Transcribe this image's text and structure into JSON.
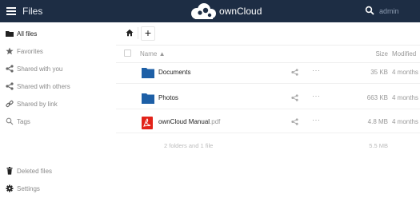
{
  "topbar": {
    "menu_icon": "hamburger-icon",
    "app_title": "Files",
    "logo_text": "ownCloud",
    "search_icon": "search-icon",
    "user": "admin"
  },
  "sidebar": {
    "items": [
      {
        "label": "All files",
        "icon": "folder-icon",
        "active": true
      },
      {
        "label": "Favorites",
        "icon": "star-icon"
      },
      {
        "label": "Shared with you",
        "icon": "share-icon"
      },
      {
        "label": "Shared with others",
        "icon": "share-icon"
      },
      {
        "label": "Shared by link",
        "icon": "link-icon"
      },
      {
        "label": "Tags",
        "icon": "tag-icon"
      }
    ],
    "bottom": [
      {
        "label": "Deleted files",
        "icon": "trash-icon"
      },
      {
        "label": "Settings",
        "icon": "gear-icon"
      }
    ]
  },
  "breadcrumb": {
    "home_icon": "home-icon",
    "add_label": "+"
  },
  "table": {
    "headers": {
      "name": "Name ▲",
      "size": "Size",
      "modified": "Modified"
    },
    "rows": [
      {
        "name": "Documents",
        "ext": "",
        "type": "folder",
        "size": "35 KB",
        "modified": "4 months ago"
      },
      {
        "name": "Photos",
        "ext": "",
        "type": "folder",
        "size": "663 KB",
        "modified": "4 months ago"
      },
      {
        "name": "ownCloud Manual",
        "ext": ".pdf",
        "type": "pdf",
        "size": "4.8 MB",
        "modified": "4 months ago"
      }
    ],
    "summary": {
      "count": "2 folders and 1 file",
      "total": "5.5 MB"
    },
    "more_label": "···"
  },
  "colors": {
    "header_bg": "#1d2d44",
    "folder": "#1d5fa6",
    "pdf": "#e2231a"
  }
}
